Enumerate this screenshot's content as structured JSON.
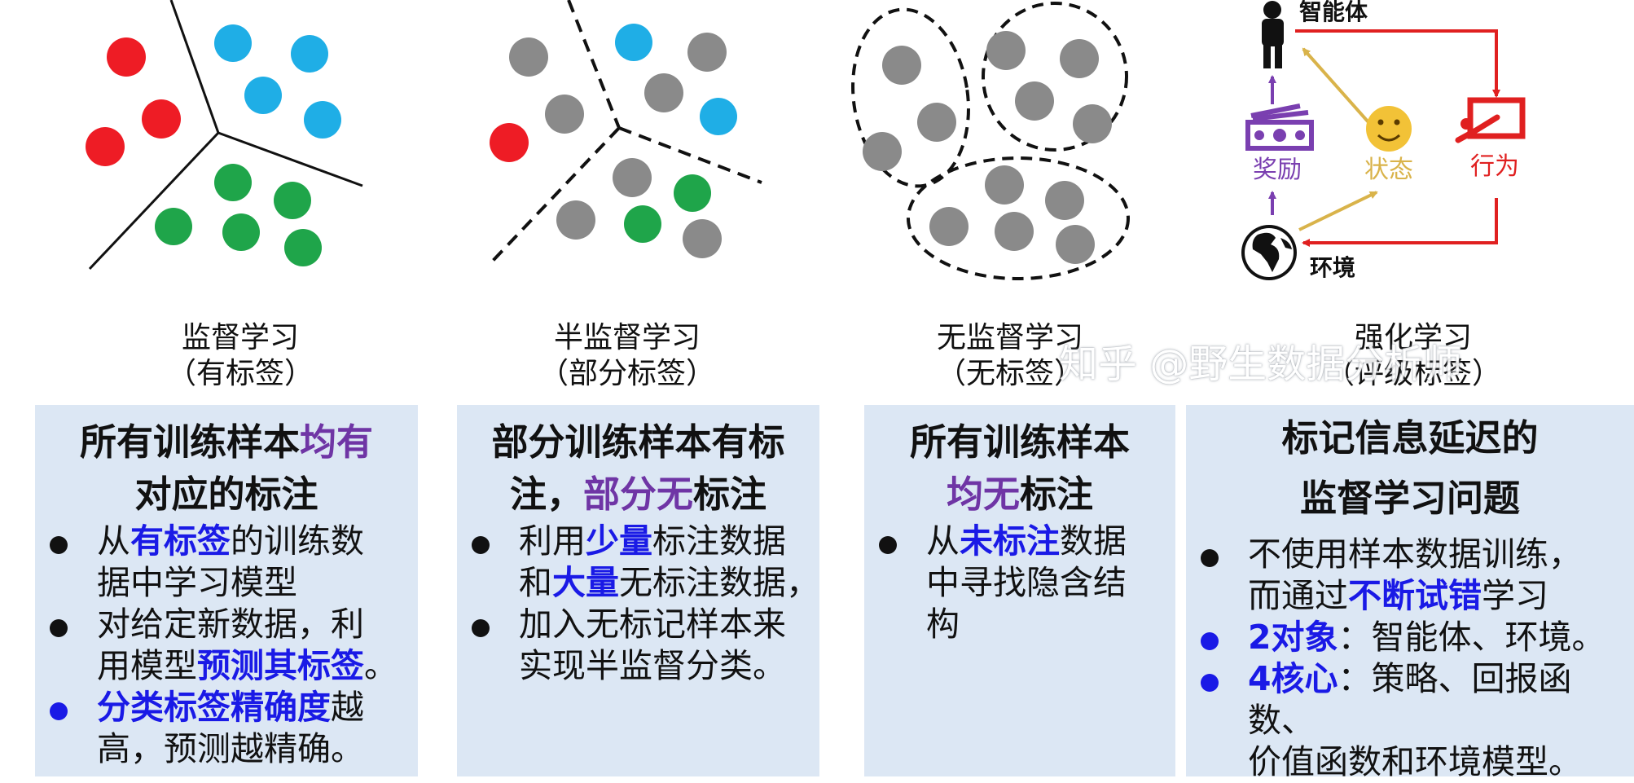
{
  "captions": [
    {
      "line1": "监督学习",
      "line2": "（有标签）"
    },
    {
      "line1": "半监督学习",
      "line2": "（部分标签）"
    },
    {
      "line1": "无监督学习",
      "line2": "（无标签）"
    },
    {
      "line1": "强化学习",
      "line2": "（评级标签）"
    }
  ],
  "watermark": "知乎 @野生数据分析师",
  "rl_labels": {
    "agent": "智能体",
    "reward": "奖励",
    "state": "状态",
    "action": "行为",
    "environment": "环境"
  },
  "colors": {
    "red": "#ee1c25",
    "blue": "#1faee6",
    "green": "#1fa54a",
    "gray": "#8a8a8a",
    "panel_bg": "#dce7f4",
    "purple": "#6f35a5",
    "emphasis_blue": "#1a1ae6",
    "rl_red": "#e02020",
    "rl_gold": "#d9b34a"
  },
  "panels": [
    {
      "heading": [
        [
          {
            "t": "所有训练样本"
          },
          {
            "t": "均有",
            "hl": true
          }
        ],
        [
          {
            "t": "对应的标注"
          }
        ]
      ],
      "bullets": [
        {
          "blue": false,
          "lines": [
            [
              {
                "t": "从"
              },
              {
                "t": "有标签",
                "em": true
              },
              {
                "t": "的训练数"
              }
            ],
            [
              {
                "t": "据中学习模型"
              }
            ]
          ]
        },
        {
          "blue": false,
          "lines": [
            [
              {
                "t": "对给定新数据，利"
              }
            ],
            [
              {
                "t": "用模型"
              },
              {
                "t": "预测其标签",
                "em": true
              },
              {
                "t": "。"
              }
            ]
          ]
        },
        {
          "blue": true,
          "lines": [
            [
              {
                "t": "分类标签精确度",
                "em": true
              },
              {
                "t": "越"
              }
            ],
            [
              {
                "t": "高，预测越精确。"
              }
            ]
          ]
        }
      ]
    },
    {
      "heading": [
        [
          {
            "t": "部分训练样本有标"
          }
        ],
        [
          {
            "t": "注，"
          },
          {
            "t": "部分无",
            "hl": true
          },
          {
            "t": "标注"
          }
        ]
      ],
      "bullets": [
        {
          "blue": false,
          "lines": [
            [
              {
                "t": "利用"
              },
              {
                "t": "少量",
                "em": true
              },
              {
                "t": "标注数据"
              }
            ],
            [
              {
                "t": "和"
              },
              {
                "t": "大量",
                "em": true
              },
              {
                "t": "无标注数据，"
              }
            ]
          ]
        },
        {
          "blue": false,
          "lines": [
            [
              {
                "t": "加入无标记样本来"
              }
            ],
            [
              {
                "t": "实现半监督分类。"
              }
            ]
          ]
        }
      ]
    },
    {
      "heading": [
        [
          {
            "t": "所有训练样本"
          }
        ],
        [
          {
            "t": "均无",
            "hl": true
          },
          {
            "t": "标注"
          }
        ]
      ],
      "bullets": [
        {
          "blue": false,
          "lines": [
            [
              {
                "t": "从"
              },
              {
                "t": "未标注",
                "em": true
              },
              {
                "t": "数据"
              }
            ],
            [
              {
                "t": "中寻找隐含结"
              }
            ],
            [
              {
                "t": "构"
              }
            ]
          ]
        }
      ]
    },
    {
      "heading": [
        [
          {
            "t": "标记信息延迟的"
          }
        ],
        [
          {
            "t": "监督学习问题"
          }
        ]
      ],
      "bullets": [
        {
          "blue": false,
          "lines": [
            [
              {
                "t": "不使用样本数据训练，"
              }
            ],
            [
              {
                "t": "而通过"
              },
              {
                "t": "不断试错",
                "em": true
              },
              {
                "t": "学习"
              }
            ]
          ]
        },
        {
          "blue": true,
          "lines": [
            [
              {
                "t": "2对象",
                "em": true
              },
              {
                "t": "：智能体、环境。"
              }
            ]
          ]
        },
        {
          "blue": true,
          "lines": [
            [
              {
                "t": "4核心",
                "em": true
              },
              {
                "t": "：策略、回报函数、"
              }
            ],
            [
              {
                "t": "价值函数和环境模型。"
              }
            ]
          ]
        }
      ]
    }
  ]
}
